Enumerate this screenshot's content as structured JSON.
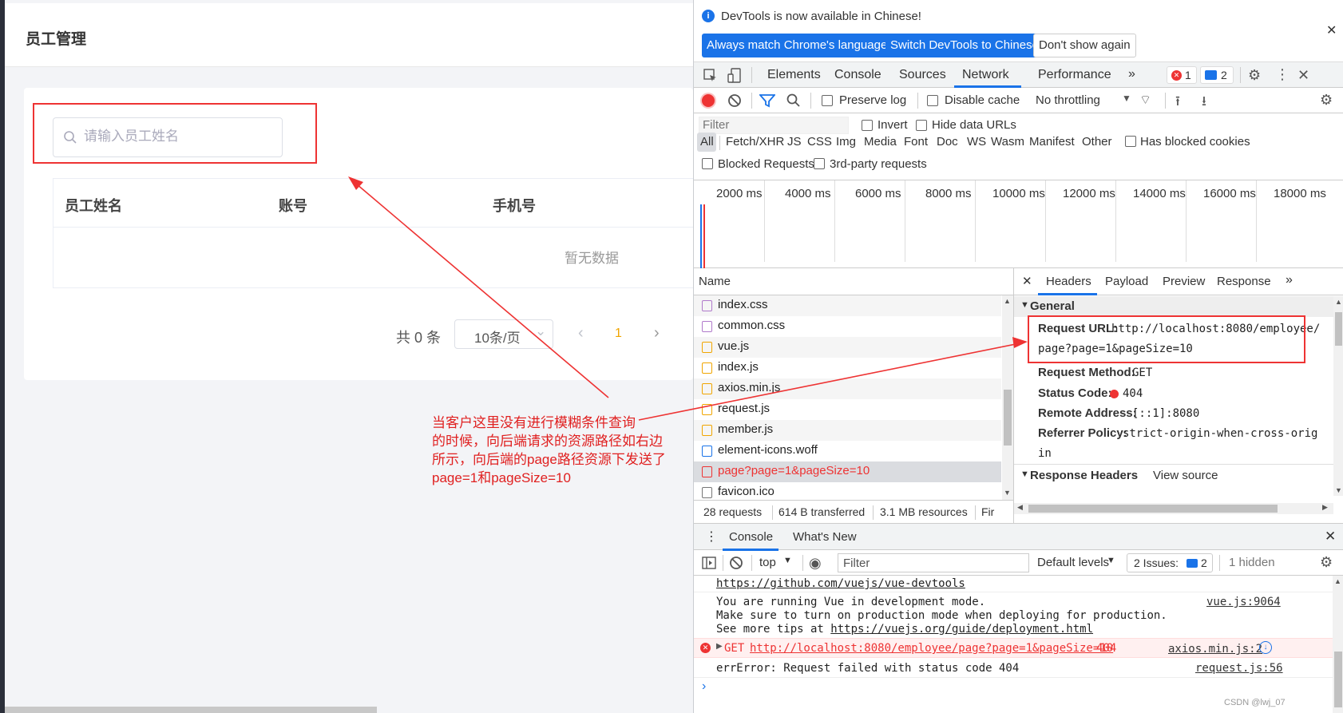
{
  "app": {
    "title": "员工管理",
    "search": {
      "placeholder": "请输入员工姓名",
      "value": ""
    },
    "table": {
      "columns": [
        "员工姓名",
        "账号",
        "手机号"
      ],
      "empty_text": "暂无数据"
    },
    "pagination": {
      "total_text": "共 0 条",
      "page_size": "10条/页",
      "current_page": "1"
    },
    "annotation": [
      "当客户这里没有进行模糊条件查询",
      "的时候，向后端请求的资源路径如右边",
      "所示，向后端的page路径资源下发送了",
      "page=1和pageSize=10"
    ]
  },
  "devtools": {
    "infobar": {
      "message": "DevTools is now available in Chinese!",
      "btn_match": "Always match Chrome's language",
      "btn_switch": "Switch DevTools to Chinese",
      "btn_dismiss": "Don't show again"
    },
    "tabs": [
      "Elements",
      "Console",
      "Sources",
      "Network",
      "Performance"
    ],
    "active_tab": "Network",
    "error_count": "1",
    "issue_count": "2",
    "network_toolbar": {
      "preserve_log": "Preserve log",
      "disable_cache": "Disable cache",
      "throttling": "No throttling"
    },
    "filter_bar": {
      "placeholder": "Filter",
      "invert": "Invert",
      "hide_data_urls": "Hide data URLs",
      "types": [
        "All",
        "Fetch/XHR",
        "JS",
        "CSS",
        "Img",
        "Media",
        "Font",
        "Doc",
        "WS",
        "Wasm",
        "Manifest",
        "Other"
      ],
      "has_blocked_cookies": "Has blocked cookies",
      "blocked_requests": "Blocked Requests",
      "third_party": "3rd-party requests"
    },
    "timeline_ticks": [
      "2000 ms",
      "4000 ms",
      "6000 ms",
      "8000 ms",
      "10000 ms",
      "12000 ms",
      "14000 ms",
      "16000 ms",
      "18000 ms"
    ],
    "requests": {
      "header": "Name",
      "items": [
        {
          "name": "index.css",
          "type": "css"
        },
        {
          "name": "common.css",
          "type": "css"
        },
        {
          "name": "vue.js",
          "type": "js"
        },
        {
          "name": "index.js",
          "type": "js"
        },
        {
          "name": "axios.min.js",
          "type": "js"
        },
        {
          "name": "request.js",
          "type": "js"
        },
        {
          "name": "member.js",
          "type": "js"
        },
        {
          "name": "element-icons.woff",
          "type": "font"
        },
        {
          "name": "page?page=1&pageSize=10",
          "type": "error"
        },
        {
          "name": "favicon.ico",
          "type": "other"
        }
      ]
    },
    "status_bar": {
      "requests": "28 requests",
      "transferred": "614 B transferred",
      "resources": "3.1 MB resources",
      "finish": "Fir"
    },
    "detail_tabs": [
      "Headers",
      "Payload",
      "Preview",
      "Response"
    ],
    "general": {
      "section": "General",
      "request_url_label": "Request URL:",
      "request_url_line1": "http://localhost:8080/employee/",
      "request_url_line2": "page?page=1&pageSize=10",
      "method_label": "Request Method:",
      "method": "GET",
      "status_label": "Status Code:",
      "status": "404",
      "remote_label": "Remote Address:",
      "remote": "[::1]:8080",
      "referrer_label": "Referrer Policy:",
      "referrer_line1": "strict-origin-when-cross-orig",
      "referrer_line2": "in"
    },
    "response_headers": {
      "section": "Response Headers",
      "view_source": "View source"
    },
    "drawer": {
      "tabs": [
        "Console",
        "What's New"
      ],
      "context": "top",
      "filter_placeholder": "Filter",
      "levels": "Default levels",
      "issues_label": "2 Issues:",
      "issues_count": "2",
      "hidden": "1 hidden",
      "lines": {
        "devtools_link": "https://github.com/vuejs/vue-devtools",
        "vue_msg1": "You are running Vue in development mode.",
        "vue_msg2": "Make sure to turn on production mode when deploying for production.",
        "vue_msg3_prefix": "See more tips at ",
        "vue_msg3_link": "https://vuejs.org/guide/deployment.html",
        "vue_src": "vue.js:9064",
        "err_method": "GET",
        "err_url": "http://localhost:8080/employee/page?page=1&pageSize=10",
        "err_code": "404",
        "err_src": "axios.min.js:2",
        "err2_msg": "errError: Request failed with status code 404",
        "err2_src": "request.js:56"
      }
    },
    "watermark": "CSDN @lwj_07"
  },
  "colors": {
    "accent": "#1a73e8",
    "error": "#e33",
    "annotation": "#e02020",
    "page_active": "#f0a500"
  }
}
